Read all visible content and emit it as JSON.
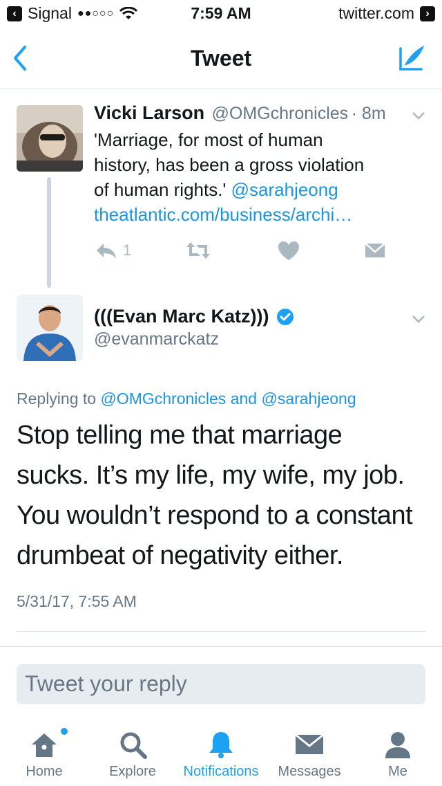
{
  "status_bar": {
    "back_app": "Signal",
    "signal_dots": "●●○○○",
    "time": "7:59 AM",
    "url": "twitter.com"
  },
  "nav": {
    "title": "Tweet"
  },
  "parent_tweet": {
    "name": "Vicki Larson",
    "handle": "@OMGchronicles",
    "age": "· 8m",
    "text_line1": "'Marriage, for most of human",
    "text_line2": "history, has been a gross violation",
    "text_line3_start": "of human rights.'",
    "mention": "@sarahjeong",
    "link": "theatlantic.com/business/archi…",
    "reply_count": "1"
  },
  "main_tweet": {
    "name": "(((Evan Marc Katz)))",
    "handle": "@evanmarckatz",
    "replying_prefix": "Replying to",
    "replying_to_1": "@OMGchronicles",
    "replying_and": "and",
    "replying_to_2": "@sarahjeong",
    "text_lines": [
      "Stop telling me that marriage",
      "sucks. It’s my life, my wife, my job.",
      "You wouldn’t respond to a constant",
      "drumbeat of negativity either."
    ],
    "timestamp": "5/31/17, 7:55 AM"
  },
  "reply": {
    "placeholder": "Tweet your reply"
  },
  "tabs": [
    {
      "label": "Home",
      "icon": "home-icon"
    },
    {
      "label": "Explore",
      "icon": "search-icon"
    },
    {
      "label": "Notifications",
      "icon": "bell-icon"
    },
    {
      "label": "Messages",
      "icon": "envelope-icon"
    },
    {
      "label": "Me",
      "icon": "person-icon"
    }
  ],
  "colors": {
    "accent": "#1da1f2",
    "link": "#1b95e0",
    "muted": "#657786",
    "verified": "#1da1f2"
  }
}
